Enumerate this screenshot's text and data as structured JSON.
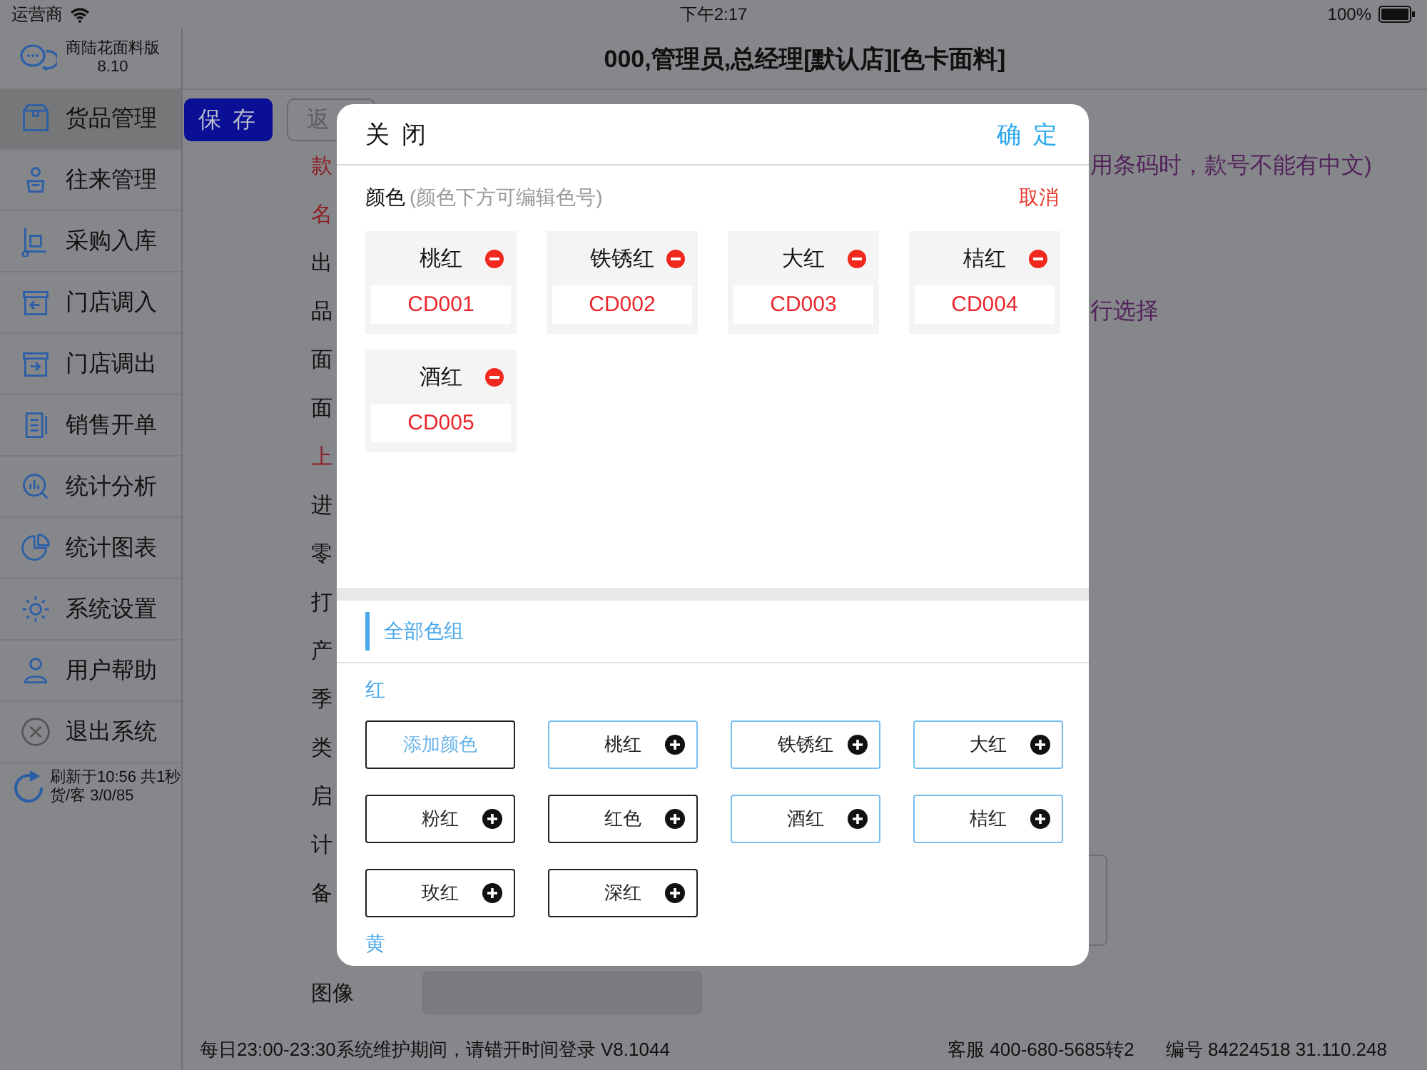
{
  "status_bar": {
    "carrier": "运营商",
    "time": "下午2:17",
    "battery": "100%"
  },
  "app": {
    "name": "商陆花面料版",
    "version": "8.10"
  },
  "header_title": "000,管理员,总经理[默认店][色卡面料]",
  "sidebar": {
    "items": [
      {
        "label": "货品管理",
        "selected": true
      },
      {
        "label": "往来管理",
        "selected": false
      },
      {
        "label": "采购入库",
        "selected": false
      },
      {
        "label": "门店调入",
        "selected": false
      },
      {
        "label": "门店调出",
        "selected": false
      },
      {
        "label": "销售开单",
        "selected": false
      },
      {
        "label": "统计分析",
        "selected": false
      },
      {
        "label": "统计图表",
        "selected": false
      },
      {
        "label": "系统设置",
        "selected": false
      },
      {
        "label": "用户帮助",
        "selected": false
      },
      {
        "label": "退出系统",
        "selected": false
      }
    ]
  },
  "refresh": {
    "line1": "刷新于10:56 共1秒",
    "line2": "货/客  3/0/85"
  },
  "toolbar": {
    "buttons": [
      {
        "label": "保 存",
        "kind": "primary"
      },
      {
        "label": "返",
        "kind": "secondary"
      }
    ]
  },
  "form": {
    "labels": [
      {
        "text": "款",
        "required": true,
        "hint": "用条码时，款号不能有中文)"
      },
      {
        "text": "名",
        "required": true
      },
      {
        "text": "出",
        "required": false
      },
      {
        "text": "品",
        "required": false,
        "hint": "行选择"
      },
      {
        "text": "面",
        "required": false
      },
      {
        "text": "面",
        "required": false
      },
      {
        "text": "上",
        "required": true
      },
      {
        "text": "进",
        "required": false
      },
      {
        "text": "零",
        "required": false
      },
      {
        "text": "打",
        "required": false
      },
      {
        "text": "产",
        "required": false
      },
      {
        "text": "季",
        "required": false
      },
      {
        "text": "类",
        "required": false
      },
      {
        "text": "启",
        "required": false
      },
      {
        "text": "计",
        "required": false
      },
      {
        "text": "备",
        "required": false
      }
    ],
    "image_label": "图像"
  },
  "footer": {
    "notice": "每日23:00-23:30系统维护期间，请错开时间登录  V8.1044",
    "service": "客服 400-680-5685转2",
    "id": "编号 84224518  31.110.248"
  },
  "dialog": {
    "close": "关 闭",
    "confirm": "确 定",
    "section_label": "颜色",
    "section_hint": "(颜色下方可编辑色号)",
    "cancel": "取消",
    "chosen": [
      {
        "name": "桃红",
        "code": "CD001"
      },
      {
        "name": "铁锈红",
        "code": "CD002"
      },
      {
        "name": "大红",
        "code": "CD003"
      },
      {
        "name": "桔红",
        "code": "CD004"
      },
      {
        "name": "酒红",
        "code": "CD005"
      }
    ],
    "groups_tab": "全部色组",
    "groups": [
      {
        "name": "红",
        "items": [
          {
            "label": "添加颜色",
            "kind": "add",
            "selected": false
          },
          {
            "label": "桃红",
            "kind": "color",
            "selected": true
          },
          {
            "label": "铁锈红",
            "kind": "color",
            "selected": true
          },
          {
            "label": "大红",
            "kind": "color",
            "selected": true
          },
          {
            "label": "粉红",
            "kind": "color",
            "selected": false
          },
          {
            "label": "红色",
            "kind": "color",
            "selected": false
          },
          {
            "label": "酒红",
            "kind": "color",
            "selected": true
          },
          {
            "label": "桔红",
            "kind": "color",
            "selected": true
          },
          {
            "label": "玫红",
            "kind": "color",
            "selected": false
          },
          {
            "label": "深红",
            "kind": "color",
            "selected": false
          }
        ]
      },
      {
        "name": "黄"
      }
    ]
  }
}
